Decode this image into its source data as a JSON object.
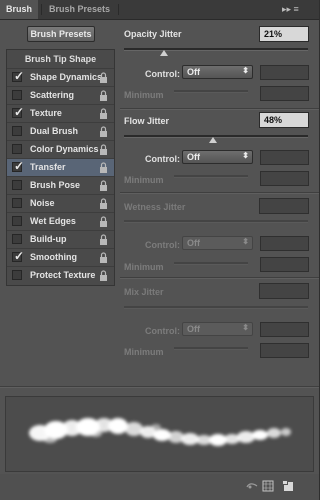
{
  "tabs": [
    {
      "label": "Brush"
    },
    {
      "label": "Brush Presets"
    }
  ],
  "menu_icons": "▸▸ ≡",
  "brush_presets_button": "Brush Presets",
  "left_list": {
    "header": "Brush Tip Shape",
    "items": [
      {
        "label": "Shape Dynamics",
        "checked": true
      },
      {
        "label": "Scattering",
        "checked": false
      },
      {
        "label": "Texture",
        "checked": true
      },
      {
        "label": "Dual Brush",
        "checked": false
      },
      {
        "label": "Color Dynamics",
        "checked": false
      },
      {
        "label": "Transfer",
        "checked": true,
        "selected": true
      },
      {
        "label": "Brush Pose",
        "checked": false
      },
      {
        "label": "Noise",
        "checked": false
      },
      {
        "label": "Wet Edges",
        "checked": false
      },
      {
        "label": "Build-up",
        "checked": false
      },
      {
        "label": "Smoothing",
        "checked": true
      },
      {
        "label": "Protect Texture",
        "checked": false
      }
    ]
  },
  "opacity_jitter": {
    "label": "Opacity Jitter",
    "value": "21%",
    "control_label": "Control:",
    "control_value": "Off",
    "minimum_label": "Minimum"
  },
  "flow_jitter": {
    "label": "Flow Jitter",
    "value": "48%",
    "control_label": "Control:",
    "control_value": "Off",
    "minimum_label": "Minimum"
  },
  "wetness_jitter": {
    "label": "Wetness Jitter",
    "control_label": "Control:",
    "control_value": "Off",
    "minimum_label": "Minimum"
  },
  "mix_jitter": {
    "label": "Mix Jitter",
    "control_label": "Control:",
    "control_value": "Off",
    "minimum_label": "Minimum"
  },
  "colors": {
    "selected_row": "#596576",
    "panel": "#535353"
  }
}
